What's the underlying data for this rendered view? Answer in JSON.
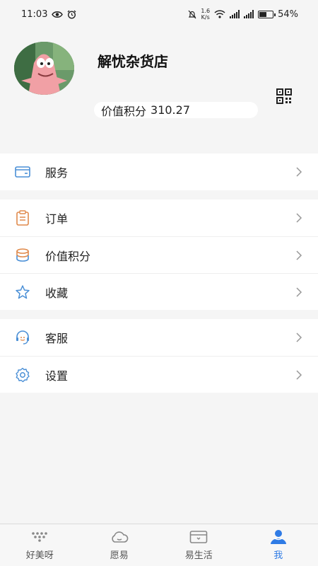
{
  "status_bar": {
    "time": "11:03",
    "net_speed_value": "1.6",
    "net_speed_unit": "K/s",
    "battery": "54%",
    "battery_level": 0.54
  },
  "profile": {
    "name": "解忧杂货店",
    "points_label": "价值积分",
    "points_value": "310.27"
  },
  "menu_groups": [
    {
      "items": [
        {
          "label": "服务",
          "icon": "wallet-icon"
        }
      ]
    },
    {
      "items": [
        {
          "label": "订单",
          "icon": "clipboard-icon"
        },
        {
          "label": "价值积分",
          "icon": "coin-stack-icon"
        },
        {
          "label": "收藏",
          "icon": "star-icon"
        }
      ]
    },
    {
      "items": [
        {
          "label": "客服",
          "icon": "headset-icon"
        },
        {
          "label": "设置",
          "icon": "gear-icon"
        }
      ]
    }
  ],
  "tabbar": {
    "tabs": [
      {
        "label": "好美呀",
        "icon": "dots-triangle-icon",
        "active": false
      },
      {
        "label": "愿易",
        "icon": "cloud-icon",
        "active": false
      },
      {
        "label": "易生活",
        "icon": "card-icon",
        "active": false
      },
      {
        "label": "我",
        "icon": "person-icon",
        "active": true
      }
    ]
  },
  "colors": {
    "accent": "#2f7be5",
    "background": "#f5f5f5",
    "icon_orange": "#e08a4c",
    "icon_blue": "#4a8fd6"
  }
}
